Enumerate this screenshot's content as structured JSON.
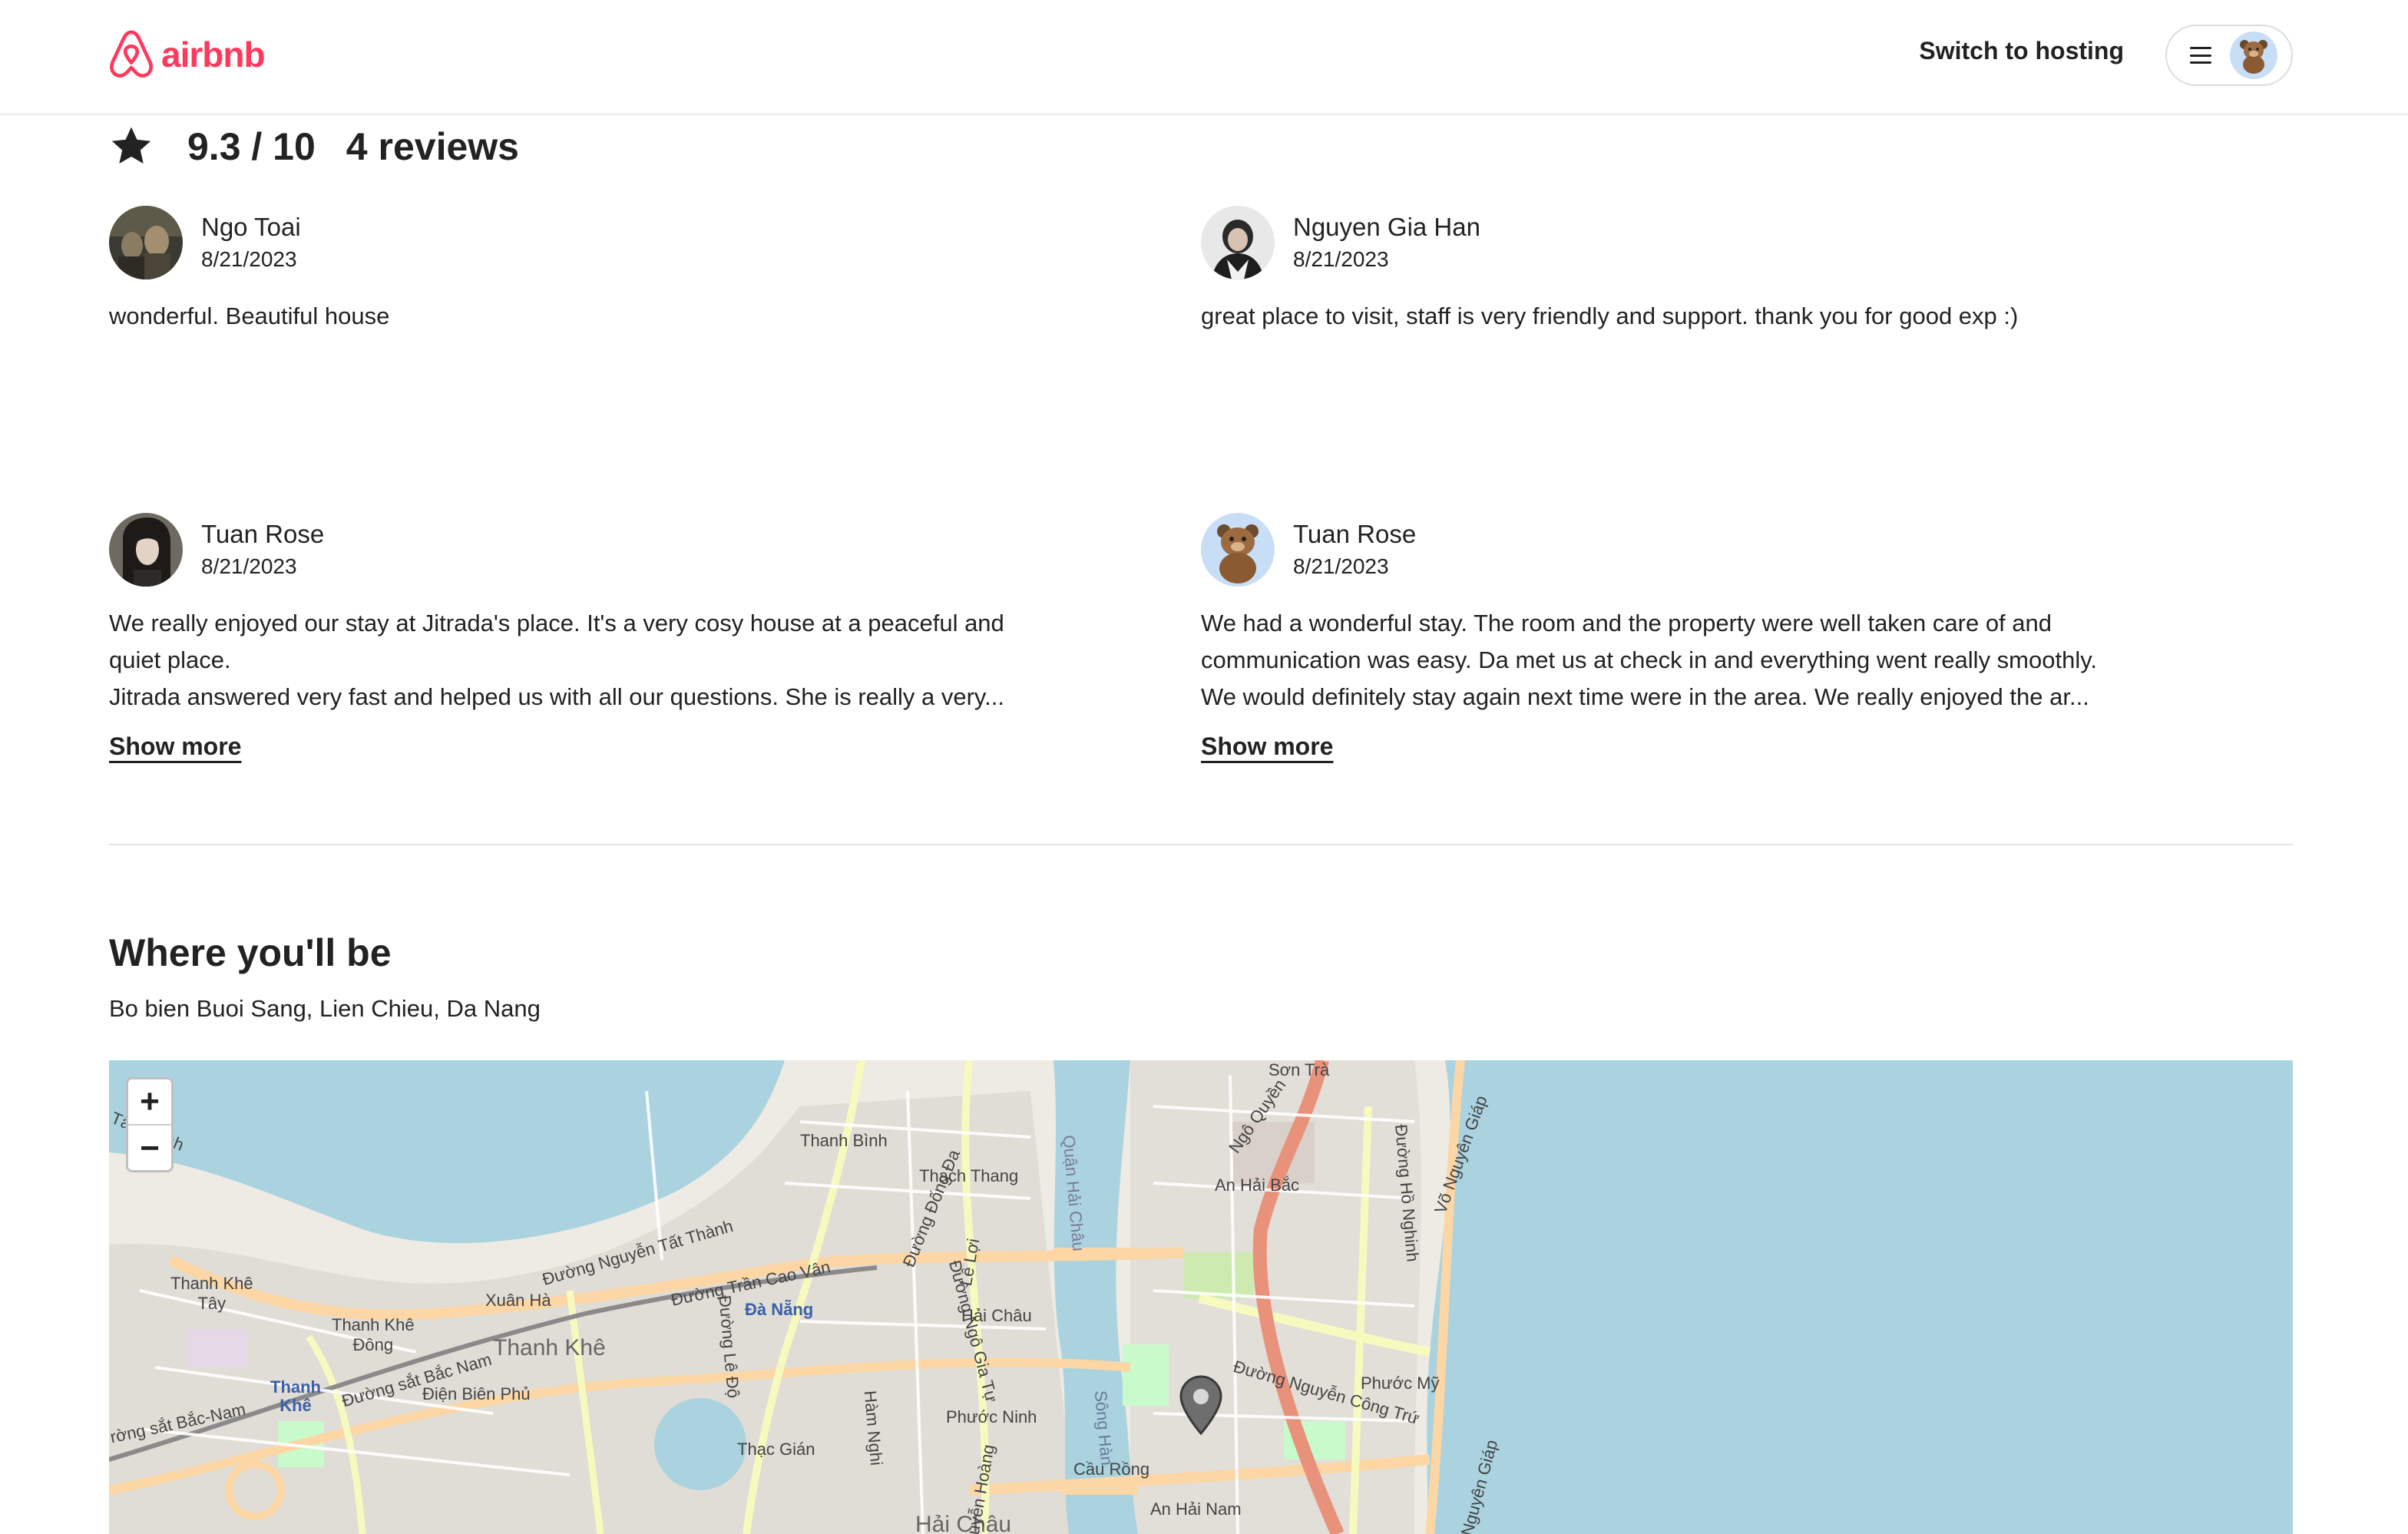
{
  "header": {
    "logo_text": "airbnb",
    "switch_hosting": "Switch to hosting",
    "menu_icon": "hamburger-icon",
    "avatar_icon": "bear-avatar-icon",
    "brand_color": "#ff385c"
  },
  "rating": {
    "icon": "star-icon",
    "score": "9.3 / 10",
    "reviews_count": "4 reviews"
  },
  "reviews": [
    {
      "name": "Ngo Toai",
      "date": "8/21/2023",
      "text": "wonderful. Beautiful house",
      "show_more": ""
    },
    {
      "name": "Nguyen Gia Han",
      "date": "8/21/2023",
      "text": "great place to visit, staff is very friendly and support. thank you for good exp :)",
      "show_more": ""
    },
    {
      "name": "Tuan Rose",
      "date": "8/21/2023",
      "text": "We really enjoyed our stay at Jitrada's place. It's a very cosy house at a peaceful and\nquiet place.\nJitrada answered very fast and helped us with all our questions. She is really a very...",
      "show_more": "Show more"
    },
    {
      "name": "Tuan Rose",
      "date": "8/21/2023",
      "text": "We had a wonderful stay. The room and the property were well taken care of and\ncommunication was easy. Da met us at check in and everything went really smoothly.\nWe would definitely stay again next time were in the area. We really enjoyed the ar...",
      "show_more": "Show more"
    }
  ],
  "location": {
    "title": "Where you'll be",
    "address": "Bo bien Buoi Sang, Lien Chieu, Da Nang"
  },
  "map": {
    "zoom_in": "+",
    "zoom_out": "−",
    "labels": {
      "son_tra": "Sơn Trà",
      "thanh_binh": "Thanh Bình",
      "thach_thang": "Thạch Thang",
      "an_hai_bac": "An Hải Bắc",
      "thanh_khe_tay": "Thanh Khê\nTây",
      "xuan_ha": "Xuân Hà",
      "da_nang": "Đà Nẵng",
      "hai_chau": "Hải Châu",
      "thanh_khe_dong": "Thanh Khê\nĐông",
      "thanh_khe": "Thanh Khê",
      "phuoc_my": "Phước Mỹ",
      "thanh_khe_small": "Thanh\nKhê",
      "phuoc_ninh": "Phước Ninh",
      "thac_gian": "Thạc Gián",
      "cau_rong": "Cầu Rồng",
      "an_hai_nam": "An Hải Nam",
      "hai_chau_2": "Hải Châu",
      "duong_nguyen_tat_thanh": "Đường Nguyễn Tất Thành",
      "duong_tran_cao_van": "Đường Trần Cao Vân",
      "duong_sat_bac_nam": "Đường sắt Bắc Nam",
      "dien_bien_phu": "Điện Biên Phủ",
      "duong_nguyen_cong_tru": "Đường Nguyễn Công Trứ",
      "ngo_quyen": "Ngô Quyền",
      "vo_nguyen_giap": "Võ Nguyên Giáp",
      "duong_ho_nghinh": "Đường Hồ Nghinh",
      "quan_hai_chau": "Quận Hải Châu",
      "song_han": "Sông Hàn",
      "duong_le_do": "Đường Lê Độ",
      "le_loi": "Lê Lợi",
      "ham_nghi": "Hàm Nghi",
      "duong_ngo_gia_tu": "Đường Ngô Gia Tự",
      "duong_dong_da": "Đường Đống Đa",
      "tat_thanh": "Tất Thành",
      "rong_sat_bac_nam": "rờng sắt Bắc-Nam",
      "nguyen_hoang": "Nguyễn Hoàng"
    }
  }
}
